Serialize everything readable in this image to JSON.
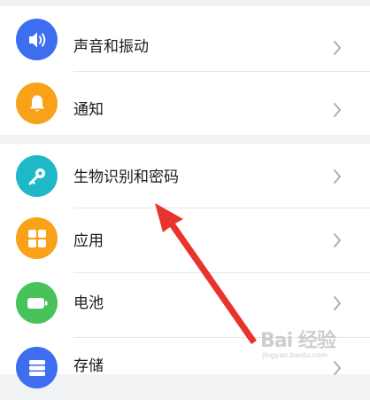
{
  "colors": {
    "background": "#f1f2f4",
    "card": "#ffffff",
    "sound_icon_bg": "#3d6ef0",
    "notification_icon_bg": "#f8a21a",
    "biometric_icon_bg": "#1fb8c8",
    "apps_icon_bg": "#f8a21a",
    "battery_icon_bg": "#48c25a",
    "storage_icon_bg": "#3d6ef0",
    "annotation_arrow": "#e8342c"
  },
  "settings": {
    "sound": {
      "label": "声音和振动",
      "icon": "speaker-icon"
    },
    "notification": {
      "label": "通知",
      "icon": "bell-icon"
    },
    "biometric": {
      "label": "生物识别和密码",
      "icon": "key-icon"
    },
    "apps": {
      "label": "应用",
      "icon": "apps-grid-icon"
    },
    "battery": {
      "label": "电池",
      "icon": "battery-icon"
    },
    "storage": {
      "label": "存储",
      "icon": "storage-icon"
    }
  },
  "watermark": {
    "main": "Bai 经验",
    "sub": "jingyan.baidu.com"
  }
}
